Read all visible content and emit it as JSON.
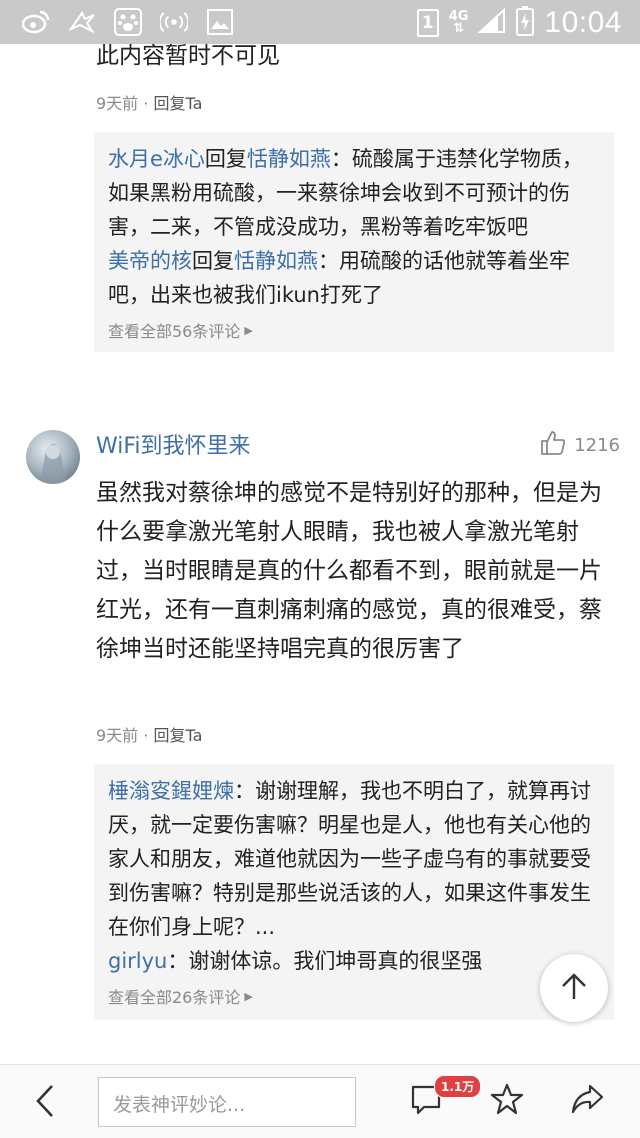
{
  "status_bar": {
    "time": "10:04",
    "sim": "1",
    "network": "4G",
    "icons": [
      "weibo-icon",
      "bird-icon",
      "baidu-paw-icon",
      "wifi-hotspot-icon",
      "gallery-icon",
      "signal-icon",
      "battery-charging-icon"
    ]
  },
  "top_comment": {
    "text_cut": "此内容暂时不可见",
    "time": "9天前",
    "separator": "·",
    "reply_label": "回复Ta"
  },
  "replies_1": {
    "items": [
      {
        "user": "水月e冰心",
        "verb": "回复",
        "target": "恬静如燕",
        "text": "：硫酸属于违禁化学物质，如果黑粉用硫酸，一来蔡徐坤会收到不可预计的伤害，二来，不管成没成功，黑粉等着吃牢饭吧"
      },
      {
        "user": "美帝的核",
        "verb": "回复",
        "target": "恬静如燕",
        "text": "：用硫酸的话他就等着坐牢吧，出来也被我们ikun打死了"
      }
    ],
    "view_all": "查看全部56条评论"
  },
  "comment": {
    "username": "WiFi到我怀里来",
    "likes": "1216",
    "text": "虽然我对蔡徐坤的感觉不是特别好的那种，但是为什么要拿激光笔射人眼睛，我也被人拿激光笔射过，当时眼睛是真的什么都看不到，眼前就是一片红光，还有一直刺痛刺痛的感觉，真的很难受，蔡徐坤当时还能坚持唱完真的很厉害了",
    "time": "9天前",
    "separator": "·",
    "reply_label": "回复Ta"
  },
  "replies_2": {
    "items": [
      {
        "user": "棰滃叜鍟娌煉",
        "text": "：谢谢理解，我也不明白了，就算再讨厌，就一定要伤害嘛？明星也是人，他也有关心他的家人和朋友，难道他就因为一些子虚乌有的事就要受到伤害嘛？特别是那些说活该的人，如果这件事发生在你们身上呢？..."
      },
      {
        "user": "girlyu",
        "text": "：谢谢体谅。我们坤哥真的很坚强"
      }
    ],
    "view_all": "查看全部26条评论"
  },
  "bottom_bar": {
    "placeholder": "发表神评妙论...",
    "comment_count": "1.1万"
  },
  "colors": {
    "username": "#3d6fa8",
    "badge": "#e04040",
    "statusbar": "#c9c9c9"
  }
}
